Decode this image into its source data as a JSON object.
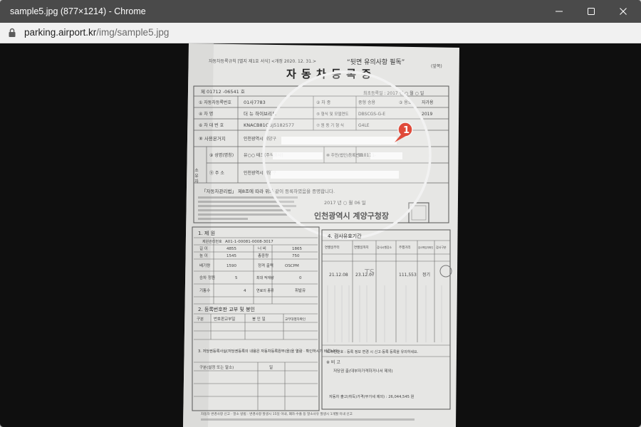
{
  "window": {
    "title": "sample5.jpg (877×1214) - Chrome",
    "url_host": "parking.airport.kr",
    "url_path": "/img/sample5.jpg"
  },
  "document": {
    "header_note": "자동차등록규칙 [별지 제1호 서식] <개정 2020. 12. 31.>",
    "header_warning": "“뒷면 유의사항 필독”",
    "side_mark": "(앞쪽)",
    "title": "자 동 차 등 록 증",
    "doc_number": "제 01712 -06541 호",
    "first_reg_label": "최초등록일 : 2017 년 ○ 월 ○ 일",
    "rows": [
      {
        "label": "① 자동차등록번호",
        "value": "01사7783",
        "label2": "② 차 종",
        "value2": "중형 승용",
        "label3": "③ 용도",
        "value3": "자가용"
      },
      {
        "label": "④ 차 명",
        "value": "더 뉴 하이브리드",
        "label2": "⑤ 형식 및 모델연도",
        "value2": "DBSCGS-G-E",
        "label3": "",
        "value3": "2019"
      },
      {
        "label": "⑥ 차 대 번 호",
        "value": "KNACB81CGJ5182577",
        "label2": "⑦ 원 동 기 형 식",
        "value2": "G4LE",
        "label3": "",
        "value3": ""
      },
      {
        "label": "⑧ 사용본거지",
        "value": "인천광역시 계양구",
        "label2": "",
        "value2": "",
        "label3": "",
        "value3": ""
      }
    ],
    "owner_label": "소 유 자",
    "name_label": "⑨ 성명(명칭)",
    "name_value": "유○○ 테크(주식회사)",
    "idnum_label": "⑩ 주민(법인)등록번호",
    "idnum_value": "110111-",
    "address_label": "⑪ 주 소",
    "address_value": "인천광역시 계양구",
    "cert_text": "「자동차관리법」 제8조에 따라 위와 같이 등록하였음을 증명합니다.",
    "cert_date": "2017 년 ○ 월 06 일",
    "issuer": "인천광역시 계양구청장",
    "annotation_number": "1",
    "section1_title": "1. 제 원",
    "spec_labels": [
      "제원관리번호",
      "길 이",
      "너 비",
      "높 이",
      "총중량",
      "배기량",
      "정격 출력",
      "승차 정원",
      "최대 적재량",
      "기통수",
      "연료의 종류"
    ],
    "spec_values": [
      "A01-1-00081-0008-3017",
      "4855",
      "1865",
      "1545",
      "750",
      "1590",
      "OSCPM",
      "5",
      "0",
      "4",
      "휘발유"
    ],
    "section2_title": "2. 등록번호판 교부 및 봉인",
    "section2_headers": [
      "구분",
      "번호판교부일",
      "봉 인 일",
      "교부대행자확인"
    ],
    "section3_title": "3. 저당권등록사실(저당권등록의 내용은 자동차등록원부(을)을 열람 · 확인하시기 바랍니다)",
    "section3_headers": [
      "구분(설정 또는 말소)",
      "일"
    ],
    "section4_title": "4. 검사유효기간",
    "section4_headers": [
      "연월일부터",
      "연월일까지",
      "검사시행장소",
      "주행거리",
      "검사책임자확인",
      "검사구분"
    ],
    "inspection_rows": [
      [
        "21.12.08",
        "23.12.07",
        "TS",
        "111,553",
        "정기"
      ]
    ],
    "remarks_label": "※ 비 고",
    "remarks_text": "저당권 출(대부자가격하거나서 제외)",
    "notice_text": "※ 주민번호 : 등록 정보 변경 시 신고·등록 등록을 유의하세요.",
    "price_text": "자동차 출고(취득)가격(부가세 제외) : 26,044,545 원",
    "footer_note": "자동차 변경사항 신고 · 말소 방법 : 변경사항 발생시 15일 이내, 폐차·수출 등 말소사유 발생시 1개월 이내 신고",
    "seal_label": "인"
  },
  "colors": {
    "titlebar": "#4a4a4a",
    "viewport_bg": "#0f0f0f",
    "paper": "#e8e8e6",
    "badge": "#e04a3a"
  }
}
